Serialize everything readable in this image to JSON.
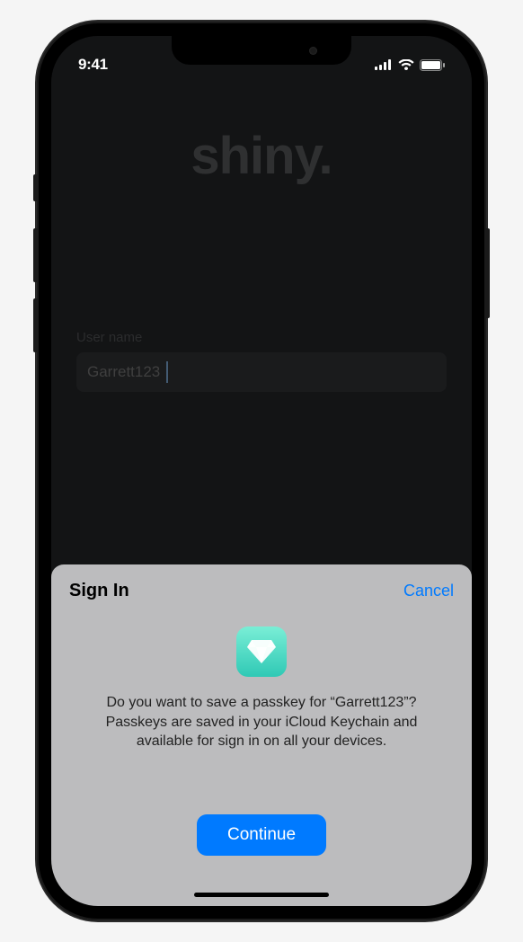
{
  "status": {
    "time": "9:41"
  },
  "app": {
    "logo": "shiny.",
    "usernameLabel": "User name",
    "usernameValue": "Garrett123"
  },
  "sheet": {
    "title": "Sign In",
    "cancel": "Cancel",
    "message": "Do you want to save a passkey for “Garrett123”? Passkeys are saved in your iCloud Keychain and available for sign in on all your devices.",
    "continue": "Continue"
  }
}
